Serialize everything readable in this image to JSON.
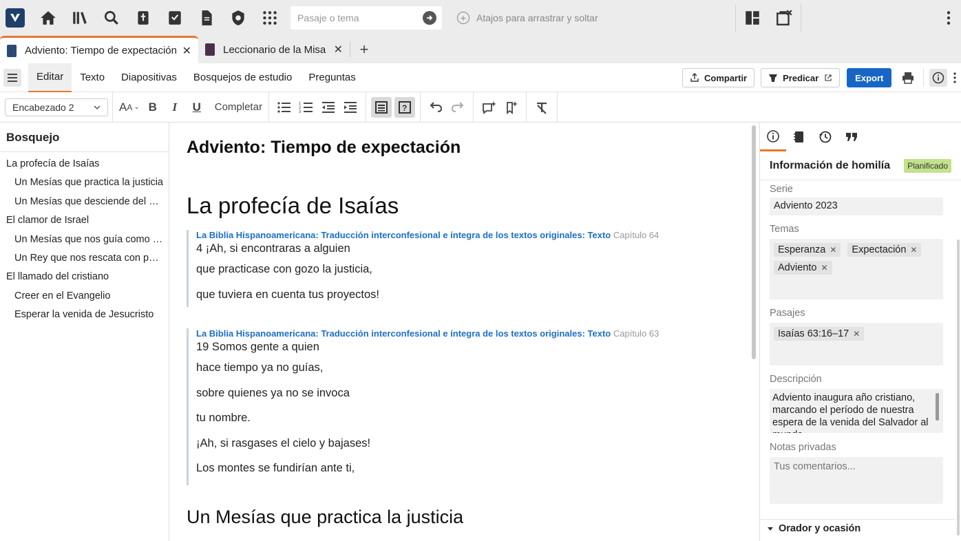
{
  "topbar": {
    "search_placeholder": "Pasaje o tema",
    "shortcuts_label": "Atajos para arrastrar y soltar"
  },
  "tabs": [
    {
      "label": "Adviento: Tiempo de expectación",
      "active": true
    },
    {
      "label": "Leccionario de la Misa",
      "active": false
    }
  ],
  "menu": {
    "items": [
      "Editar",
      "Texto",
      "Diapositivas",
      "Bosquejos de estudio",
      "Preguntas"
    ],
    "share_label": "Compartir",
    "preach_label": "Predicar",
    "export_label": "Export"
  },
  "format": {
    "style_value": "Encabezado 2",
    "complete_label": "Completar"
  },
  "outline": {
    "title": "Bosquejo",
    "items": [
      {
        "label": "La profecía de Isaías",
        "level": 1
      },
      {
        "label": "Un Mesías que practica la justicia",
        "level": 2
      },
      {
        "label": "Un Mesías que desciende del cielo",
        "level": 2
      },
      {
        "label": "El clamor de Israel",
        "level": 1
      },
      {
        "label": "Un Mesías que nos guía como pastor",
        "level": 2
      },
      {
        "label": "Un Rey que nos rescata con poder",
        "level": 2
      },
      {
        "label": "El llamado del cristiano",
        "level": 1
      },
      {
        "label": "Creer en el Evangelio",
        "level": 2
      },
      {
        "label": "Esperar la venida de Jesucristo",
        "level": 2
      }
    ]
  },
  "document": {
    "title": "Adviento: Tiempo de expectación",
    "heading1": "La profecía de Isaías",
    "quote1": {
      "source": "La Biblia Hispanoamericana: Traducción interconfesional e íntegra de los textos originales: Texto",
      "chapter": "Capítulo 64",
      "lines": [
        "4 ¡Ah, si encontraras a alguien",
        "que practicase con gozo la justicia,",
        "que tuviera en cuenta tus proyectos!"
      ]
    },
    "quote2": {
      "source": "La Biblia Hispanoamericana: Traducción interconfesional e íntegra de los textos originales: Texto",
      "chapter": "Capítulo 63",
      "lines": [
        "19 Somos gente a quien",
        "hace tiempo ya no guías,",
        "sobre quienes ya no se invoca",
        "tu nombre.",
        "¡Ah, si rasgases el cielo y bajases!",
        "Los montes se fundirían ante ti,"
      ]
    },
    "heading2": "Un Mesías que practica la justicia"
  },
  "info_panel": {
    "title": "Información de homilía",
    "status": "Planificado",
    "serie_label": "Serie",
    "serie_value": "Adviento 2023",
    "temas_label": "Temas",
    "temas": [
      "Esperanza",
      "Expectación",
      "Adviento"
    ],
    "pasajes_label": "Pasajes",
    "pasajes": [
      "Isaías 63:16–17"
    ],
    "descripcion_label": "Descripción",
    "descripcion_value": "Adviento inaugura año cristiano, marcando el período de nuestra espera de la venida del Salvador al mundo.",
    "notas_label": "Notas privadas",
    "notas_placeholder": "Tus comentarios...",
    "orador_label": "Orador y ocasión"
  },
  "colors": {
    "accent_orange": "#e8762c",
    "primary_blue": "#1766c6",
    "link_blue": "#1d6fc7",
    "badge_green": "#c3e28b"
  }
}
